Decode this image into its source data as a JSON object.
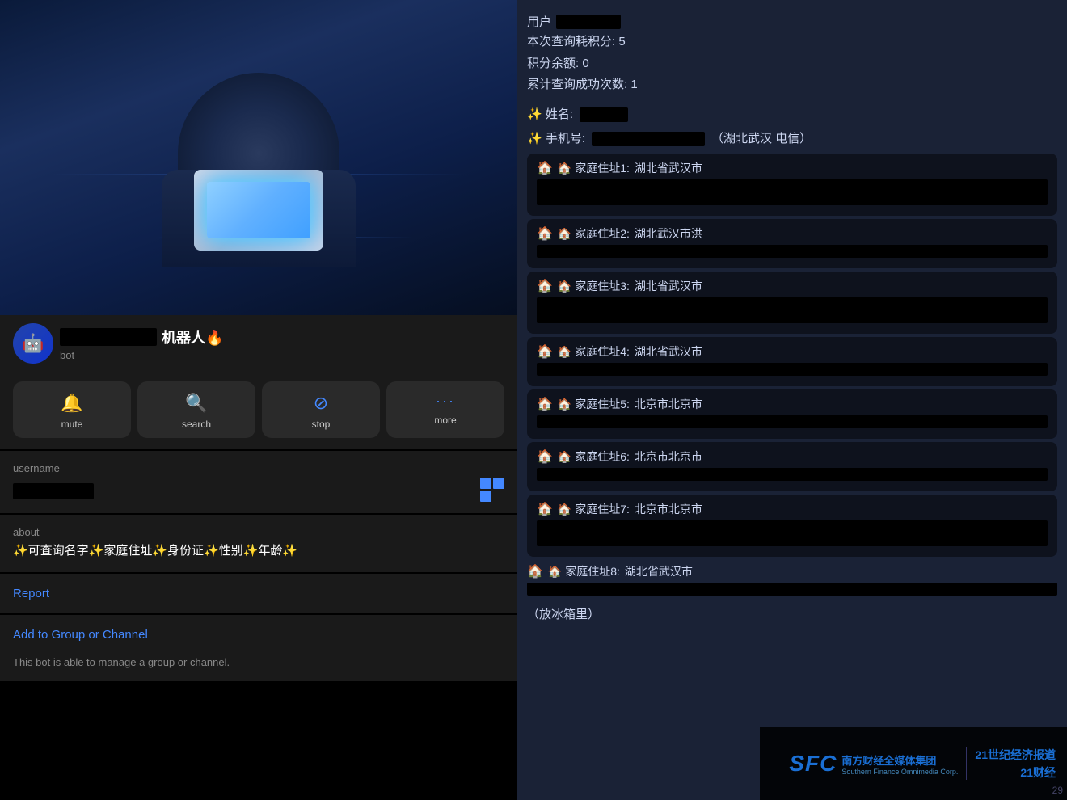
{
  "left": {
    "bot_name_redact": "",
    "bot_name_suffix": "机器人🔥",
    "bot_label": "bot",
    "actions": [
      {
        "id": "mute",
        "label": "mute",
        "icon": "🔔"
      },
      {
        "id": "search",
        "label": "search",
        "icon": "🔍"
      },
      {
        "id": "stop",
        "label": "stop",
        "icon": "⊘"
      },
      {
        "id": "more",
        "label": "more",
        "icon": "···"
      }
    ],
    "username_label": "username",
    "about_label": "about",
    "about_text": "✨可查询名字✨家庭住址✨身份证✨性别✨年龄✨",
    "report_text": "Report",
    "add_group_text": "Add to Group or Channel",
    "bot_note": "This bot is able to manage a group or channel."
  },
  "right": {
    "user_label": "用户",
    "query_cost": "本次查询耗积分: 5",
    "score_remaining": "积分余额: 0",
    "total_queries": "累计查询成功次数: 1",
    "name_label": "✨ 姓名:",
    "phone_label": "✨ 手机号:",
    "phone_location": "（湖北武汉 电信）",
    "addresses": [
      {
        "label": "🏠 家庭住址1:",
        "value": "湖北省武汉市",
        "redacted": true
      },
      {
        "label": "🏠 家庭住址2:",
        "value": "湖北武汉市洪",
        "redacted": true
      },
      {
        "label": "🏠 家庭住址3:",
        "value": "湖北省武汉市",
        "redacted": true
      },
      {
        "label": "🏠 家庭住址4:",
        "value": "湖北省武汉市",
        "redacted": true
      },
      {
        "label": "🏠 家庭住址5:",
        "value": "北京市北京市",
        "redacted": true
      },
      {
        "label": "🏠 家庭住址6:",
        "value": "北京市北京市",
        "redacted": true
      },
      {
        "label": "🏠 家庭住址7:",
        "value": "北京市北京市",
        "redacted": true
      },
      {
        "label": "🏠 家庭住址8:",
        "value": "湖北省武汉市",
        "redacted": true
      }
    ],
    "bottom_text": "（放冰箱里）",
    "watermark": {
      "sfc_brand": "SFC",
      "sfc_name_cn": "南方财经全媒体集团",
      "sfc_name_en": "Southern Finance Omnimedia Corp.",
      "media1": "21世纪经济报道",
      "media2": "21财经",
      "page_num": "29"
    }
  }
}
